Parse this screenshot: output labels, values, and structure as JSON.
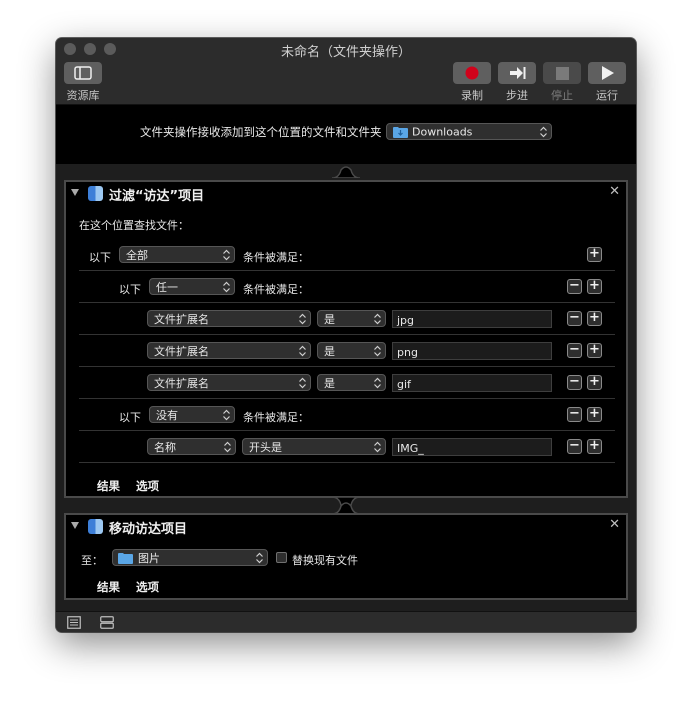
{
  "window": {
    "title": "未命名（文件夹操作）",
    "toolbar": {
      "library_label": "资源库",
      "record_label": "录制",
      "step_label": "步进",
      "stop_label": "停止",
      "run_label": "运行"
    }
  },
  "header": {
    "description": "文件夹操作接收添加到这个位置的文件和文件夹",
    "folder_value": "Downloads"
  },
  "filter_action": {
    "title": "过滤“访达”项目",
    "search_label": "在这个位置查找文件：",
    "rows": [
      {
        "prefix": "以下",
        "select": "全部",
        "suffix": "条件被满足："
      },
      {
        "prefix": "以下",
        "select": "任一",
        "suffix": "条件被满足："
      },
      {
        "field": "文件扩展名",
        "operator": "是",
        "value": "jpg"
      },
      {
        "field": "文件扩展名",
        "operator": "是",
        "value": "png"
      },
      {
        "field": "文件扩展名",
        "operator": "是",
        "value": "gif"
      },
      {
        "prefix": "以下",
        "select": "没有",
        "suffix": "条件被满足："
      },
      {
        "field": "名称",
        "operator": "开头是",
        "value": "IMG_"
      }
    ],
    "tabs": {
      "results": "结果",
      "options": "选项"
    }
  },
  "move_action": {
    "title": "移动访达项目",
    "to_label": "至：",
    "destination": "图片",
    "replace_label": "替换现有文件",
    "tabs": {
      "results": "结果",
      "options": "选项"
    }
  },
  "colors": {
    "record": "#d0021b",
    "folder": "#5aa6e6",
    "finder": "#3d7fd8"
  }
}
